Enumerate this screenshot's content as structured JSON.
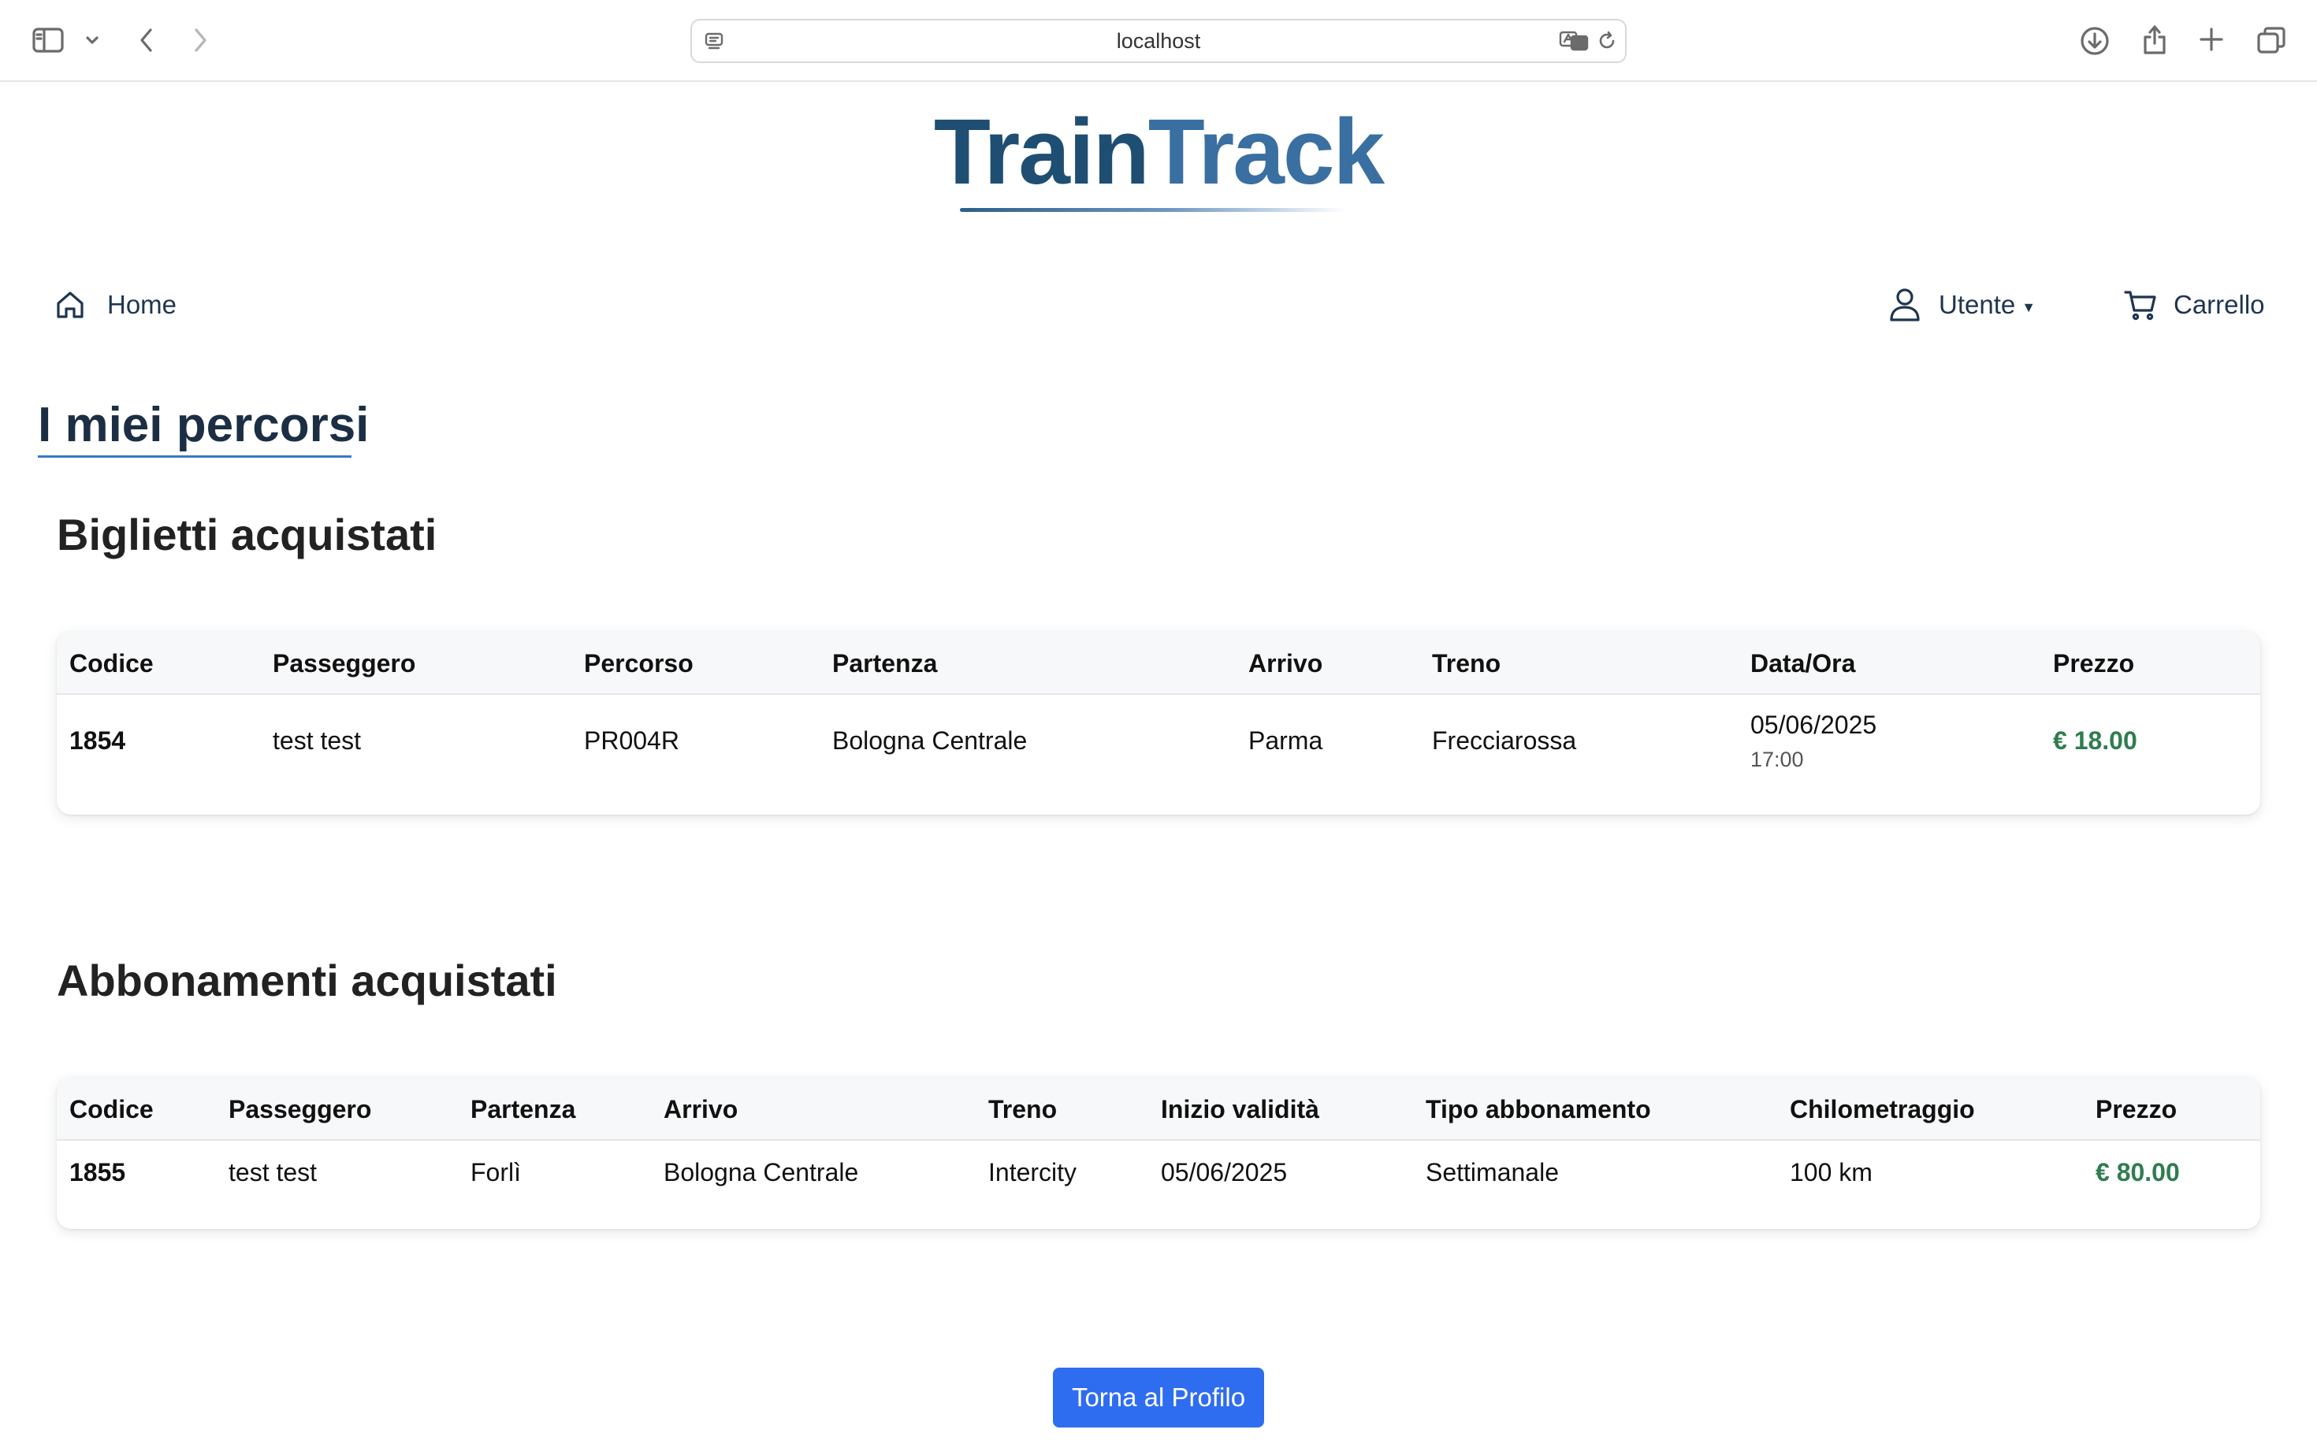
{
  "browser": {
    "url": "localhost"
  },
  "logo": {
    "part1": "Train",
    "part2": "Track"
  },
  "nav": {
    "home": "Home",
    "user": "Utente",
    "cart": "Carrello"
  },
  "page": {
    "title": "I miei percorsi"
  },
  "tickets": {
    "title": "Biglietti acquistati",
    "headers": [
      "Codice",
      "Passeggero",
      "Percorso",
      "Partenza",
      "Arrivo",
      "Treno",
      "Data/Ora",
      "Prezzo"
    ],
    "rows": [
      {
        "codice": "1854",
        "passeggero": "test test",
        "percorso": "PR004R",
        "partenza": "Bologna Centrale",
        "arrivo": "Parma",
        "treno": "Frecciarossa",
        "data": "05/06/2025",
        "ora": "17:00",
        "prezzo": "€ 18.00"
      }
    ]
  },
  "subscriptions": {
    "title": "Abbonamenti acquistati",
    "headers": [
      "Codice",
      "Passeggero",
      "Partenza",
      "Arrivo",
      "Treno",
      "Inizio validità",
      "Tipo abbonamento",
      "Chilometraggio",
      "Prezzo"
    ],
    "rows": [
      {
        "codice": "1855",
        "passeggero": "test test",
        "partenza": "Forlì",
        "arrivo": "Bologna Centrale",
        "treno": "Intercity",
        "inizio": "05/06/2025",
        "tipo": "Settimanale",
        "km": "100 km",
        "prezzo": "€ 80.00"
      }
    ]
  },
  "actions": {
    "back": "Torna al Profilo"
  },
  "colors": {
    "accent": "#2f6df0",
    "price": "#2e7d4f",
    "logo_dark": "#1f4e73",
    "logo_light": "#3a6fa1"
  }
}
